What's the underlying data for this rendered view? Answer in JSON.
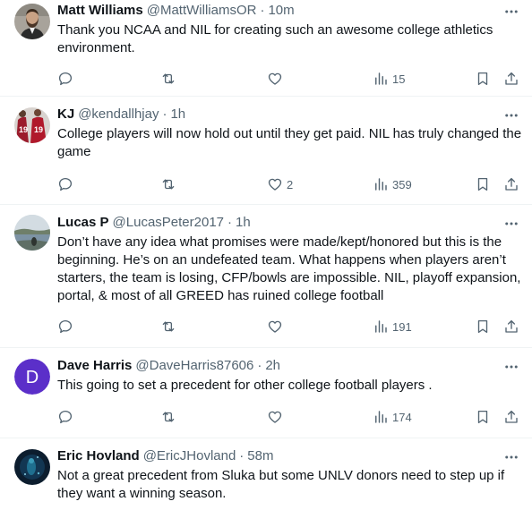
{
  "tweets": [
    {
      "name": "Matt Williams",
      "handle": "@MattWilliamsOR",
      "time": "10m",
      "text": "Thank you NCAA and NIL for creating such an awesome college athletics environment.",
      "likes": "",
      "views": "15",
      "avatar_icon": "bearded-man-avatar"
    },
    {
      "name": "KJ",
      "handle": "@kendallhjay",
      "time": "1h",
      "text": "College players will now hold out until they get paid. NIL has truly changed the game",
      "likes": "2",
      "views": "359",
      "avatar_icon": "football-jersey-avatar"
    },
    {
      "name": "Lucas P",
      "handle": "@LucasPeter2017",
      "time": "1h",
      "text": "Don’t have any idea what promises were made/kept/honored but this is the beginning. He’s on an undefeated team. What happens when players aren’t starters, the team is losing, CFP/bowls are impossible. NIL, playoff expansion, portal, & most of all GREED has ruined college football",
      "likes": "",
      "views": "191",
      "avatar_icon": "lake-landscape-avatar"
    },
    {
      "name": "Dave Harris",
      "handle": "@DaveHarris87606",
      "time": "2h",
      "text": "This going to set a precedent for other college football players .",
      "likes": "",
      "views": "174",
      "avatar_icon": "letter-d-avatar",
      "avatar_letter": "D",
      "avatar_color": "#5b2fc9"
    },
    {
      "name": "Eric Hovland",
      "handle": "@EricJHovland",
      "time": "58m",
      "text": "Not a great precedent from Sluka but some UNLV donors need to step up if they want a winning season.",
      "likes": "",
      "views": "",
      "avatar_icon": "underwater-diver-avatar"
    }
  ],
  "separator": "·",
  "colors": {
    "text_primary": "#0f1419",
    "text_secondary": "#536471",
    "divider": "#eff3f4"
  }
}
